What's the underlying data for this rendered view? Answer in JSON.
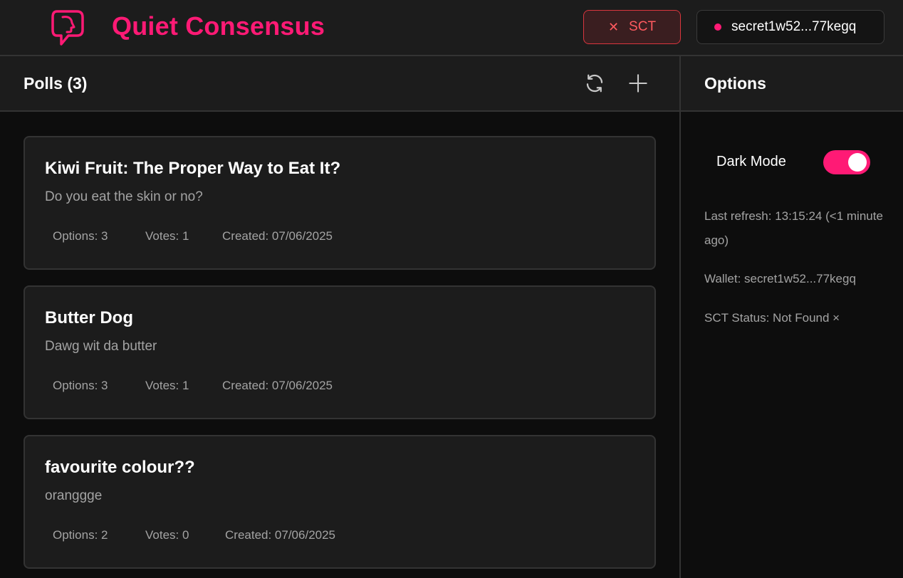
{
  "app": {
    "title": "Quiet Consensus",
    "brand_color": "#ff1a75"
  },
  "header": {
    "sct_button_label": "SCT",
    "sct_button_icon": "close-icon",
    "wallet_button_label": "secret1w52...77kegq"
  },
  "polls": {
    "title": "Polls (3)",
    "refresh_icon": "refresh-icon",
    "add_icon": "plus-icon",
    "items": [
      {
        "title": "Kiwi Fruit: The Proper Way to Eat It?",
        "description": "Do you eat the skin or no?",
        "options": "Options: 3",
        "votes": "Votes: 1",
        "created": "Created: 07/06/2025"
      },
      {
        "title": "Butter Dog",
        "description": "Dawg wit da butter",
        "options": "Options: 3",
        "votes": "Votes: 1",
        "created": "Created: 07/06/2025"
      },
      {
        "title": "favourite colour??",
        "description": "oranggge",
        "options": "Options: 2",
        "votes": "Votes: 0",
        "created": "Created: 07/06/2025"
      }
    ]
  },
  "options_panel": {
    "title": "Options",
    "dark_mode_label": "Dark Mode",
    "dark_mode_on": true,
    "last_refresh": "Last refresh: 13:15:24 (<1 minute ago)",
    "wallet": "Wallet: secret1w52...77kegq",
    "sct_status": "SCT Status: Not Found ×"
  }
}
